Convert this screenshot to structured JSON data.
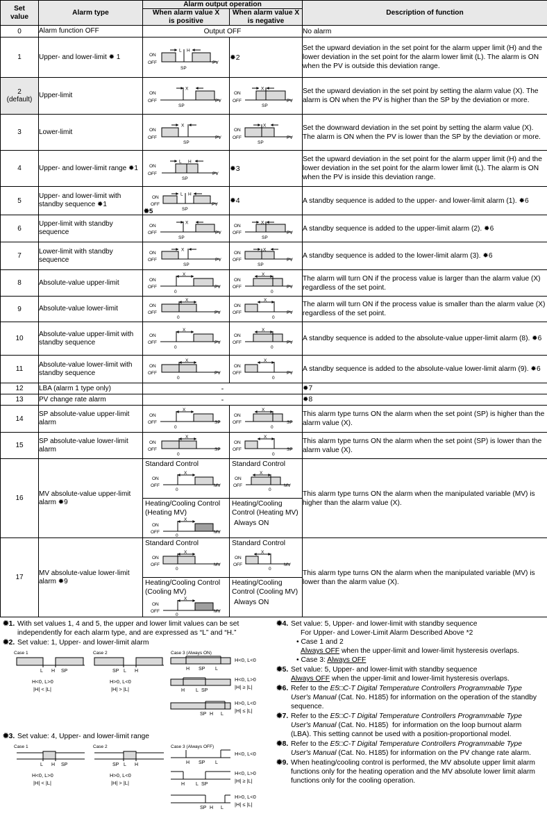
{
  "table": {
    "headers": {
      "set_value": "Set\nvalue",
      "alarm_type": "Alarm type",
      "alarm_output_operation": "Alarm output operation",
      "when_positive": "When alarm value X\nis positive",
      "when_negative": "When alarm value X\nis negative",
      "description": "Description of function"
    },
    "rows": [
      {
        "set_value": "0",
        "alarm_type": "Alarm function OFF",
        "output_span": "Output OFF",
        "description": "No alarm"
      },
      {
        "set_value": "1",
        "alarm_type": "Upper- and lower-limit ✹ 1",
        "negative_note": "✹2",
        "description": "Set the upward deviation in the set point for the alarm upper limit (H) and the lower deviation in the set point for the alarm lower limit (L). The alarm is ON when the PV is outside this deviation range."
      },
      {
        "set_value": "2\n(default)",
        "alarm_type": "Upper-limit",
        "description": "Set the upward deviation in the set point by setting the alarm value (X). The alarm is ON when the PV is higher than the SP by the deviation or more."
      },
      {
        "set_value": "3",
        "alarm_type": "Lower-limit",
        "description": "Set the downward deviation in the set point by setting the alarm value (X). The alarm is ON when the PV is lower than the SP by the deviation or more."
      },
      {
        "set_value": "4",
        "alarm_type": "Upper- and lower-limit range ✹1",
        "negative_note": "✹3",
        "description": "Set the upward deviation in the set point for the alarm upper limit (H) and the lower deviation in the set point for the alarm lower limit (L). The alarm is ON when the PV is inside this deviation range."
      },
      {
        "set_value": "5",
        "alarm_type": "Upper- and lower-limit with standby sequence ✹1",
        "negative_note": "✹4",
        "extra_marker": "✹5",
        "description": "A standby sequence is added to the upper- and lower-limit alarm (1). ✹6"
      },
      {
        "set_value": "6",
        "alarm_type": "Upper-limit with standby sequence",
        "description": "A standby sequence is added to the upper-limit alarm (2). ✹6"
      },
      {
        "set_value": "7",
        "alarm_type": "Lower-limit with standby sequence",
        "description": "A standby sequence is added to the lower-limit alarm (3). ✹6"
      },
      {
        "set_value": "8",
        "alarm_type": "Absolute-value upper-limit",
        "description": "The alarm will turn ON if the process value is larger than the alarm value (X) regardless of the set point."
      },
      {
        "set_value": "9",
        "alarm_type": "Absolute-value lower-limit",
        "description": "The alarm will turn ON if the process value is smaller than the alarm value (X) regardless of the set point."
      },
      {
        "set_value": "10",
        "alarm_type": "Absolute-value upper-limit with standby sequence",
        "description": "A standby sequence is added to the absolute-value upper-limit alarm (8). ✹6"
      },
      {
        "set_value": "11",
        "alarm_type": "Absolute-value lower-limit with standby sequence",
        "description": "A standby sequence is added to the absolute-value lower-limit alarm (9). ✹6"
      },
      {
        "set_value": "12",
        "alarm_type": "LBA (alarm 1 type only)",
        "output_span": "-",
        "description": "✹7"
      },
      {
        "set_value": "13",
        "alarm_type": "PV change rate alarm",
        "output_span": "-",
        "description": "✹8"
      },
      {
        "set_value": "14",
        "alarm_type": "SP absolute-value upper-limit alarm",
        "description": "This alarm type turns ON the alarm when the set point (SP) is higher than the alarm value (X)."
      },
      {
        "set_value": "15",
        "alarm_type": "SP absolute-value lower-limit alarm",
        "description": "This alarm type turns ON the alarm when the set point (SP) is lower than the alarm value (X)."
      },
      {
        "set_value": "16",
        "alarm_type": "MV absolute-value upper-limit alarm ✹9",
        "sub_pos_top": "Standard Control",
        "sub_neg_top": "Standard Control",
        "sub_pos_bottom": "Heating/Cooling Control (Heating MV)",
        "sub_neg_bottom": "Heating/Cooling Control (Heating MV)",
        "always_on": "Always ON",
        "description": "This alarm type turns ON the alarm when the manipulated variable (MV) is higher than the alarm value (X)."
      },
      {
        "set_value": "17",
        "alarm_type": "MV absolute-value lower-limit alarm ✹9",
        "sub_pos_top": "Standard Control",
        "sub_neg_top": "Standard Control",
        "sub_pos_bottom": "Heating/Cooling Control (Cooling MV)",
        "sub_neg_bottom": "Heating/Cooling Control (Cooling MV)",
        "always_on": "Always ON",
        "description": "This alarm type turns ON the alarm when the manipulated variable (MV) is lower than the alarm value (X)."
      }
    ]
  },
  "diagram_labels": {
    "on": "ON",
    "off": "OFF",
    "sp": "SP",
    "pv": "PV",
    "mv": "MV",
    "zero": "0",
    "x": "X",
    "l": "L",
    "h": "H"
  },
  "footnotes": {
    "left": [
      {
        "marker": "✹1.",
        "text": "With set values 1, 4 and 5, the upper and lower limit values can be set  independently for each alarm type, and are expressed as “L” and “H.”"
      },
      {
        "marker": "✹2.",
        "text": "Set value: 1, Upper- and lower-limit alarm",
        "figure": "fig2"
      },
      {
        "marker": "✹3.",
        "text": "Set value: 4, Upper- and lower-limit range",
        "figure": "fig3"
      }
    ],
    "right": [
      {
        "marker": "✹4.",
        "text": "Set value: 5, Upper- and lower-limit with standby sequence",
        "lines": [
          {
            "indent": "sub",
            "text": "For Upper- and Lower-Limit Alarm Described Above *2"
          },
          {
            "indent": "bullet",
            "text": "• Case 1 and 2"
          },
          {
            "indent": "sub",
            "html": "<u>Always OFF</u> when the upper-limit and lower-limit hysteresis overlaps."
          },
          {
            "indent": "bullet",
            "html": "• Case 3: <u>Always OFF</u>"
          }
        ]
      },
      {
        "marker": "✹5.",
        "text": "Set value: 5, Upper- and lower-limit with standby sequence",
        "lines": [
          {
            "indent": "none",
            "html": "<u>Always OFF</u> when the upper-limit and lower-limit hysteresis overlaps."
          }
        ]
      },
      {
        "marker": "✹6.",
        "html": "Refer to the <em>E5□C-T Digital Temperature Controllers Programmable Type User's Manual</em> (Cat. No. H185) for information on the operation of the standby sequence."
      },
      {
        "marker": "✹7.",
        "html": "Refer to the <em>E5□C-T Digital Temperature Controllers Programmable Type User's Manual</em> (Cat. No. H185)  for information on the loop burnout alarm (LBA). This setting cannot be used with a position-proportional model."
      },
      {
        "marker": "✹8.",
        "html": "Refer to the <em>E5□C-T Digital Temperature Controllers Programmable Type User's Manual</em> (Cat. No. H185) for information on the PV change rate alarm."
      },
      {
        "marker": "✹9.",
        "text": "When heating/cooling control is performed, the MV absolute upper limit alarm functions only for the heating operation and the MV absolute lower limit alarm functions only for the cooling operation."
      }
    ]
  },
  "footnote_figures": {
    "fig2": {
      "title_case1": "Case 1",
      "title_case2": "Case 2",
      "title_case3": "Case 3 (Always ON)",
      "case1_labels": [
        "L",
        "H",
        "SP"
      ],
      "case1_cond1": "H<0, L>0",
      "case1_cond2": "|H| < |L|",
      "case2_labels": [
        "SP",
        "L",
        "H"
      ],
      "case2_cond1": "H>0, L<0",
      "case2_cond2": "|H| > |L|",
      "case3_rows": [
        {
          "labels": [
            "H",
            "SP",
            "L"
          ],
          "cond1": "H<0, L<0",
          "cond2": ""
        },
        {
          "labels": [
            "H",
            "L",
            "SP"
          ],
          "cond1": "H<0, L>0",
          "cond2": "|H| ≥ |L|"
        },
        {
          "labels": [
            "SP",
            "H",
            "L"
          ],
          "cond1": "H>0, L<0",
          "cond2": "|H| ≤ |L|"
        }
      ]
    },
    "fig3": {
      "title_case1": "Case 1",
      "title_case2": "Case 2",
      "title_case3": "Case 3 (Always OFF)",
      "case1_labels": [
        "L",
        "H",
        "SP"
      ],
      "case1_cond1": "H<0, L>0",
      "case1_cond2": "|H| < |L|",
      "case2_labels": [
        "SP",
        "L",
        "H"
      ],
      "case2_cond1": "H>0, L<0",
      "case2_cond2": "|H| > |L|",
      "case3_rows": [
        {
          "labels": [
            "H",
            "SP",
            "L"
          ],
          "cond1": "H<0, L<0",
          "cond2": ""
        },
        {
          "labels": [
            "H",
            "L",
            "SP"
          ],
          "cond1": "H<0, L>0",
          "cond2": "|H| ≥ |L|"
        },
        {
          "labels": [
            "SP",
            "H",
            "L"
          ],
          "cond1": "H>0, L<0",
          "cond2": "|H| ≤ |L|"
        }
      ]
    }
  },
  "colors": {
    "header_bg": "#e8e8e8",
    "shade": "#d9d9d9",
    "border": "#000000"
  }
}
